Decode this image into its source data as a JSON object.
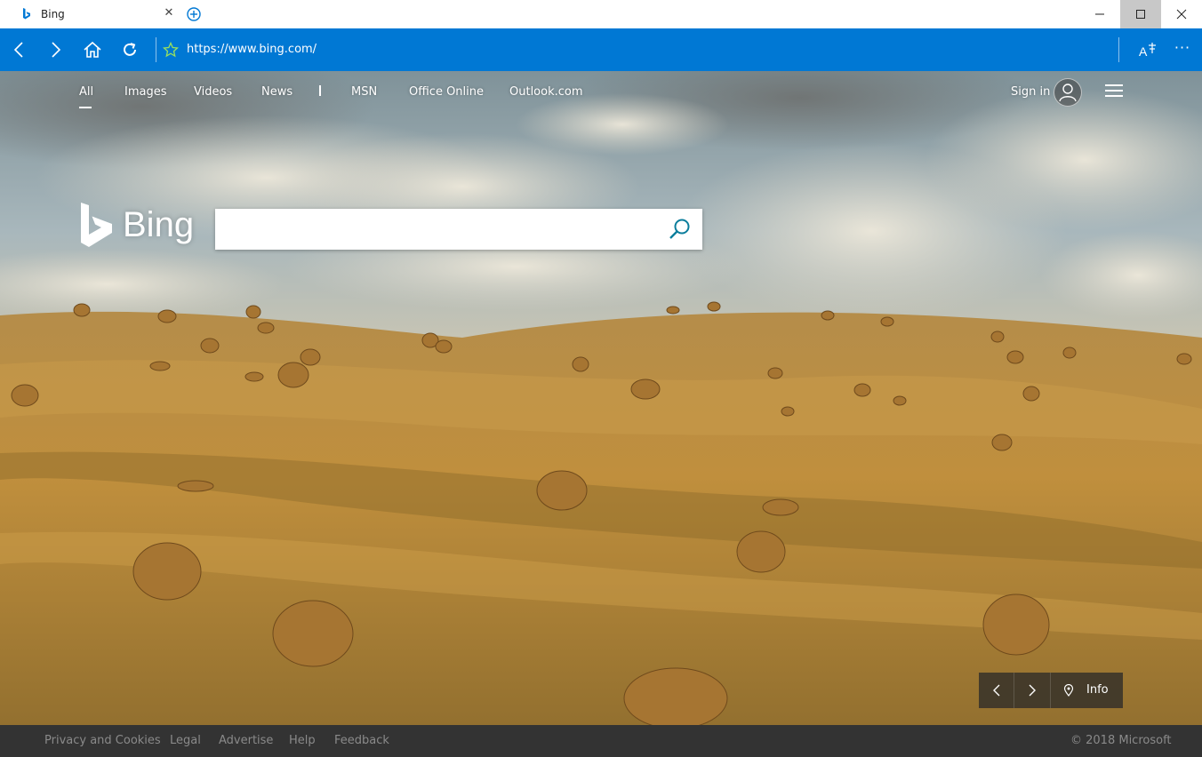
{
  "tab": {
    "title": "Bing",
    "favicon": "bing-icon"
  },
  "window_controls": {
    "minimize": "—",
    "maximize": "☐",
    "close": "✕"
  },
  "address_bar": {
    "url": "https://www.bing.com/"
  },
  "top_nav": {
    "items": [
      "All",
      "Images",
      "Videos",
      "News",
      "MSN",
      "Office Online",
      "Outlook.com"
    ],
    "active": "All",
    "signin": "Sign in"
  },
  "logo": {
    "wordmark": "Bing"
  },
  "search": {
    "value": "",
    "placeholder": ""
  },
  "image_controls": {
    "info_label": "Info"
  },
  "footer": {
    "links": [
      "Privacy and Cookies",
      "Legal",
      "Advertise",
      "Help",
      "Feedback"
    ],
    "copyright": "© 2018 Microsoft"
  },
  "colors": {
    "chrome_blue": "#0078d4",
    "footer_bg": "#333333",
    "search_icon": "#0c7e9c"
  }
}
